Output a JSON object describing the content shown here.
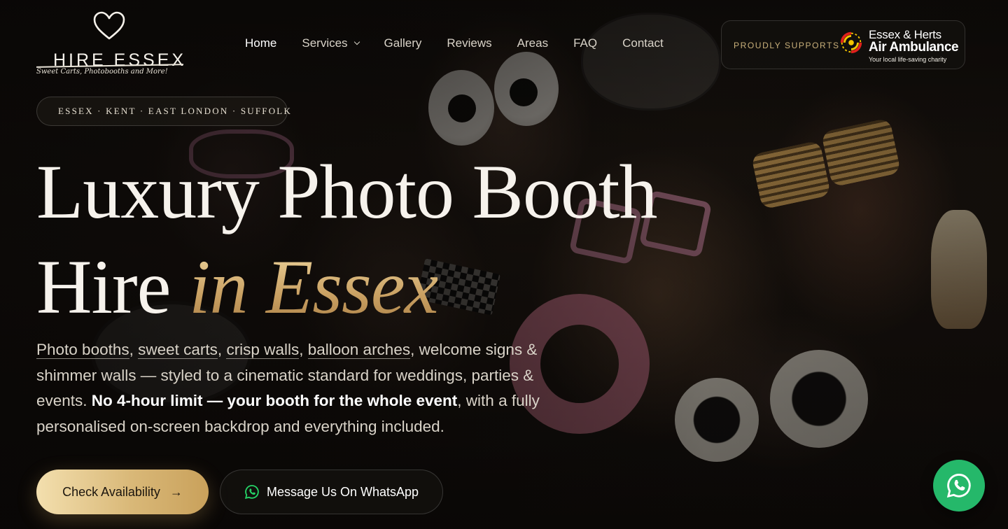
{
  "brand": {
    "name": "HIRE ESSEX",
    "tagline": "Sweet Carts, Photobooths and More!"
  },
  "nav": {
    "items": [
      {
        "label": "Home",
        "active": true
      },
      {
        "label": "Services",
        "has_dropdown": true
      },
      {
        "label": "Gallery"
      },
      {
        "label": "Reviews"
      },
      {
        "label": "Areas"
      },
      {
        "label": "FAQ"
      },
      {
        "label": "Contact"
      }
    ]
  },
  "supports": {
    "label": "PROUDLY SUPPORTS",
    "charity_line1": "Essex & Herts",
    "charity_line2": "Air Ambulance",
    "charity_tagline": "Your local life-saving charity"
  },
  "hero": {
    "areas": "ESSEX · KENT · EAST LONDON · SUFFOLK",
    "headline_line1": "Luxury Photo Booth",
    "headline_line2_plain": "Hire ",
    "headline_line2_accent": "in Essex",
    "desc_services": [
      "Photo booths",
      "sweet carts",
      "crisp walls",
      "balloon arches"
    ],
    "desc_sep": ", ",
    "desc_part1": " welcome signs & shimmer walls — styled to a cinematic standard for weddings, parties & events. ",
    "desc_bold": "No 4-hour limit — your booth for the whole event",
    "desc_part2": ", with a fully personalised on-screen backdrop and everything included."
  },
  "cta": {
    "primary_label": "Check Availability",
    "secondary_label": "Message Us On WhatsApp"
  },
  "colors": {
    "accent_gold": "#c9a062",
    "whatsapp_green": "#25b86a",
    "background": "#0b0907"
  },
  "icons": [
    "heart-icon",
    "chevron-down-icon",
    "air-ambulance-logo",
    "arrow-right-icon",
    "whatsapp-icon"
  ]
}
